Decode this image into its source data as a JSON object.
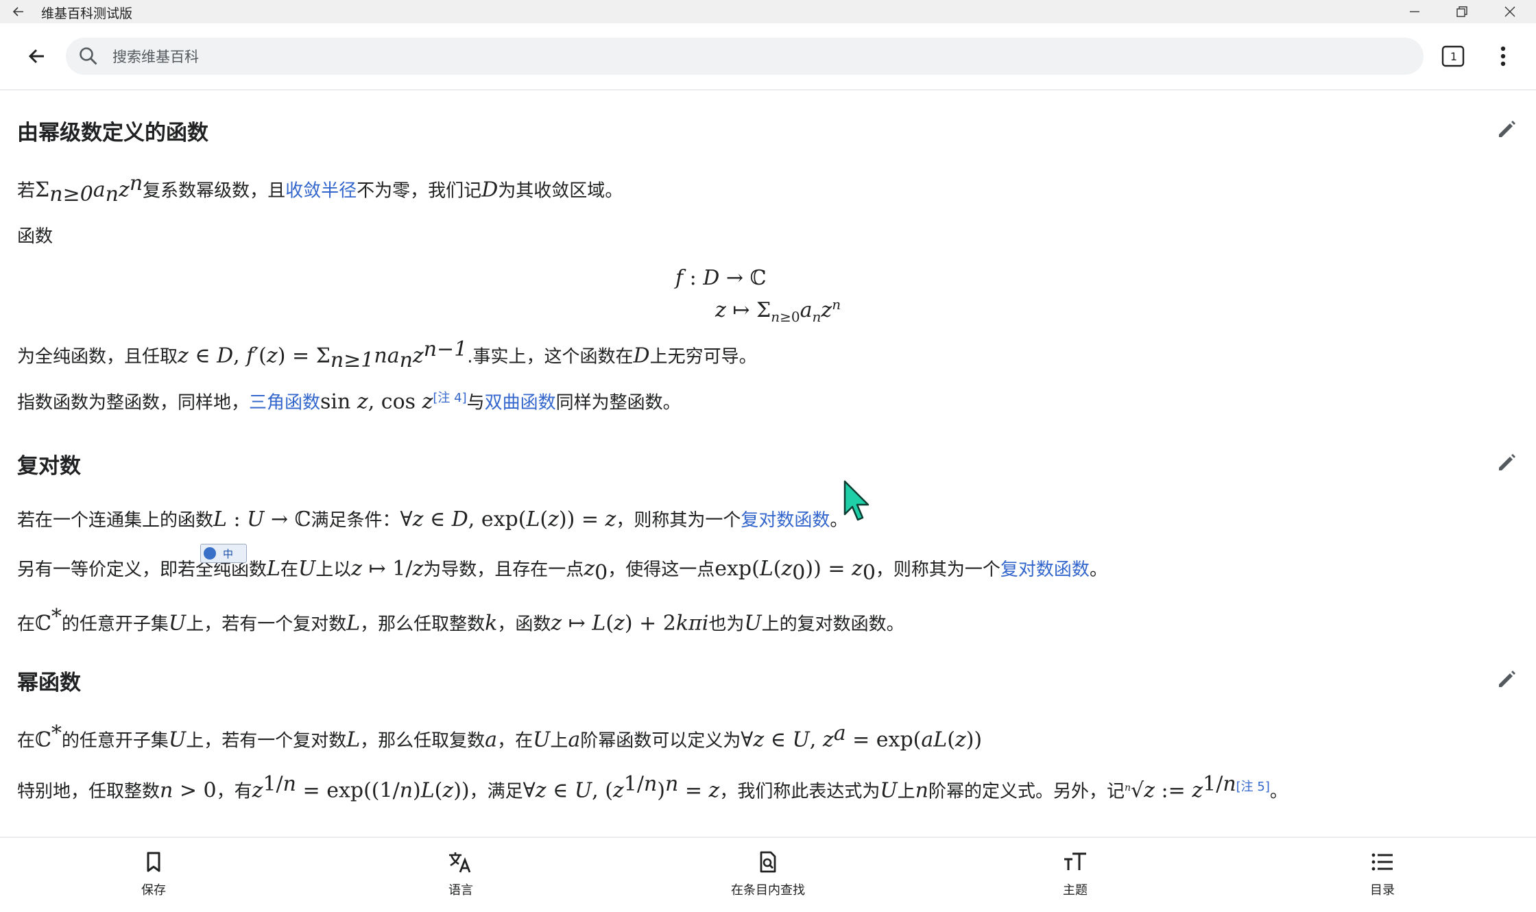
{
  "window": {
    "title": "维基百科测试版"
  },
  "search": {
    "placeholder": "搜索维基百科"
  },
  "tabs": {
    "count": "1"
  },
  "sections": {
    "s1": {
      "heading": "由幂级数定义的函数",
      "p1": {
        "t1": "若",
        "t2": "复系数幂级数，且",
        "link": "收敛半径",
        "t3": "不为零，我们记",
        "t4": "为其收敛区域。"
      },
      "p2": "函数",
      "p3": {
        "t1": "为全纯函数，且任取",
        "t2": ".事实上，这个函数在",
        "t3": "上无穷可导。"
      },
      "p4": {
        "t1": "指数函数为整函数，同样地，",
        "link1": "三角函数",
        "ref": "[注 4]",
        "t2": "与",
        "link2": "双曲函数",
        "t3": "同样为整函数。"
      }
    },
    "s2": {
      "heading": "复对数",
      "p1": {
        "t1": "若在一个连通集上的函数",
        "t2": "满足条件：",
        "t3": "，则称其为一个",
        "link": "复对数函数",
        "t4": "。"
      },
      "p2": {
        "t1": "另有一等价定义，即若全纯函数",
        "t2": "在",
        "t3": "上以",
        "t4": "为导数，且存在一点",
        "t5": "，使得这一点",
        "t6": "，则称其为一个",
        "link": "复对数函数",
        "t7": "。"
      },
      "p3": {
        "t1": "在",
        "t2": "的任意开子集",
        "t3": "上，若有一个复对数",
        "t4": "，那么任取整数",
        "t5": "，函数",
        "t6": "也为",
        "t7": "上的复对数函数。"
      }
    },
    "s3": {
      "heading": "幂函数",
      "p1": {
        "t1": "在",
        "t2": "的任意开子集",
        "t3": "上，若有一个复对数",
        "t4": "，那么任取复数",
        "t5": "，在",
        "t6": "上",
        "t7": "阶幂函数可以定义为"
      },
      "p2": {
        "t1": "特别地，任取整数",
        "t2": "，有",
        "t3": "，满足",
        "t4": "，我们称此表达式为",
        "t5": "上",
        "t6": "阶幂的定义式。另外，记",
        "ref": "[注 5]",
        "t7": "。"
      }
    }
  },
  "bottom_nav": [
    {
      "label": "保存",
      "icon": "bookmark-icon"
    },
    {
      "label": "语言",
      "icon": "translate-icon"
    },
    {
      "label": "在条目内查找",
      "icon": "find-in-page-icon"
    },
    {
      "label": "主题",
      "icon": "text-size-icon"
    },
    {
      "label": "目录",
      "icon": "list-icon"
    }
  ],
  "colors": {
    "link": "#3366cc",
    "text": "#202122",
    "titlebar": "#f0f0f0"
  }
}
